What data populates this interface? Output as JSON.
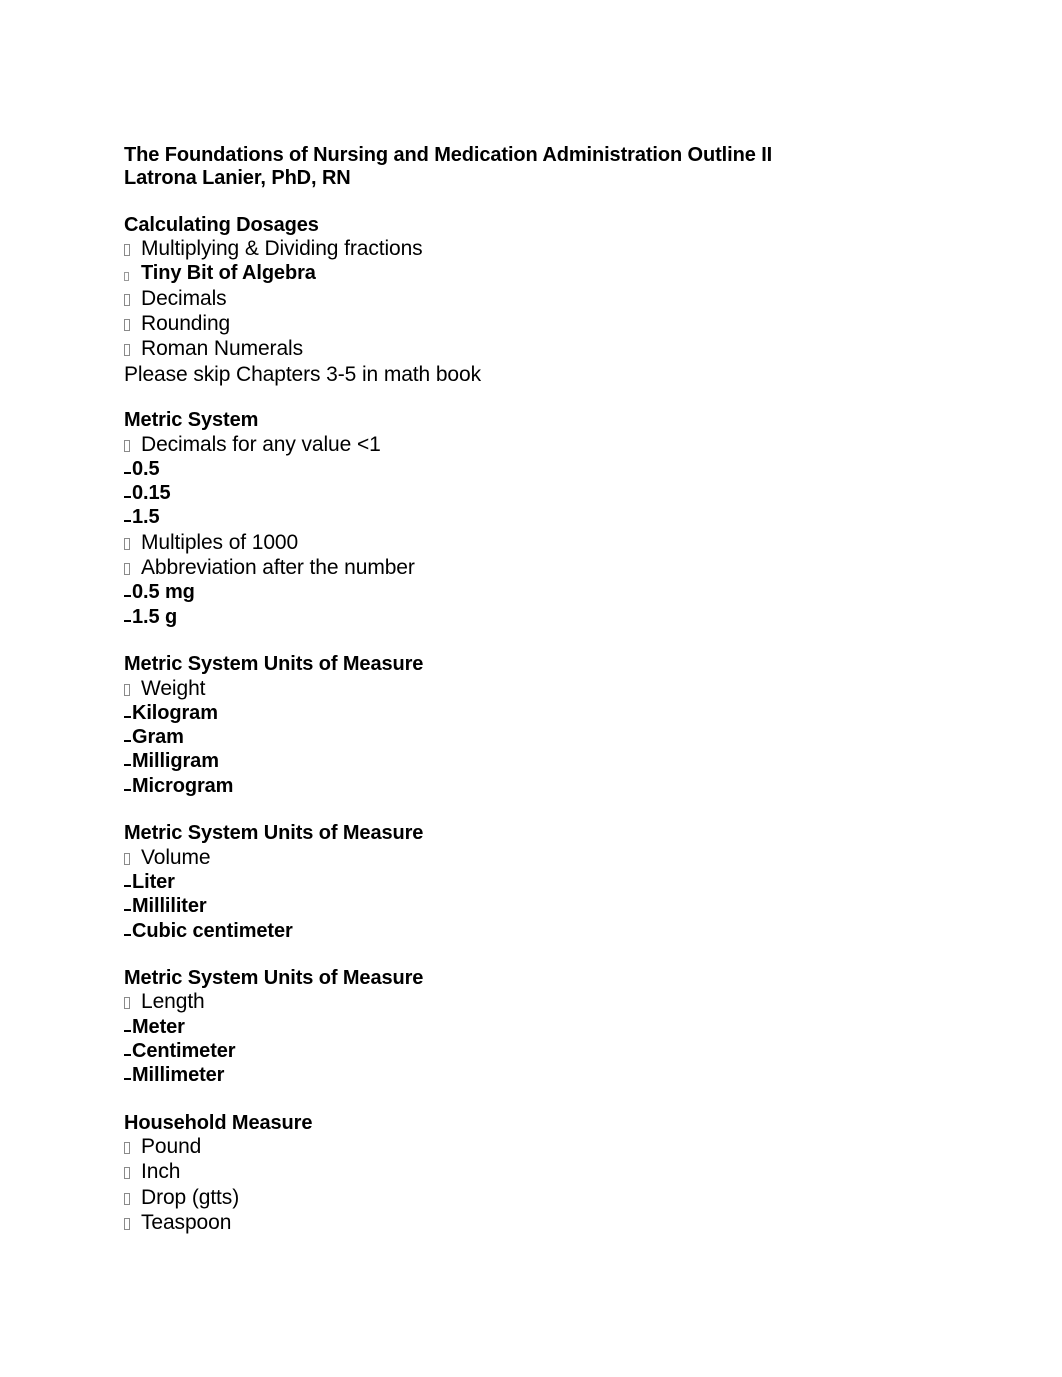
{
  "document": {
    "title_line_1": "The Foundations of Nursing and Medication Administration Outline II",
    "author_line": "Latrona Lanier, PhD, RN"
  },
  "sections": [
    {
      "heading": "Calculating Dosages",
      "items": [
        {
          "marker": "tofu",
          "text": "Multiplying & Dividing fractions",
          "bold": false
        },
        {
          "marker": "tofu",
          "text": "Tiny Bit of Algebra",
          "bold": true
        },
        {
          "marker": "tofu",
          "text": "Decimals",
          "bold": false
        },
        {
          "marker": "tofu",
          "text": "Rounding",
          "bold": false
        },
        {
          "marker": "tofu",
          "text": "Roman Numerals",
          "bold": false
        },
        {
          "marker": "none",
          "text": "Please skip Chapters 3-5 in math book",
          "bold": false
        }
      ]
    },
    {
      "heading": "Metric System",
      "items": [
        {
          "marker": "tofu",
          "text": "Decimals for any value <1",
          "bold": false
        },
        {
          "marker": "dash",
          "text": "0.5",
          "bold": true
        },
        {
          "marker": "dash",
          "text": "0.15",
          "bold": true
        },
        {
          "marker": "dash",
          "text": "1.5",
          "bold": true
        },
        {
          "marker": "tofu",
          "text": "Multiples of 1000",
          "bold": false
        },
        {
          "marker": "tofu",
          "text": "Abbreviation after the number",
          "bold": false
        },
        {
          "marker": "dash",
          "text": "0.5 mg",
          "bold": true
        },
        {
          "marker": "dash",
          "text": "1.5 g",
          "bold": true
        }
      ]
    },
    {
      "heading": "Metric System Units of Measure",
      "items": [
        {
          "marker": "tofu",
          "text": "Weight",
          "bold": false
        },
        {
          "marker": "dash",
          "text": "Kilogram",
          "bold": true
        },
        {
          "marker": "dash",
          "text": "Gram",
          "bold": true
        },
        {
          "marker": "dash",
          "text": "Milligram",
          "bold": true
        },
        {
          "marker": "dash",
          "text": "Microgram",
          "bold": true
        }
      ]
    },
    {
      "heading": "Metric System Units of Measure",
      "items": [
        {
          "marker": "tofu",
          "text": "Volume",
          "bold": false
        },
        {
          "marker": "dash",
          "text": "Liter",
          "bold": true
        },
        {
          "marker": "dash",
          "text": "Milliliter",
          "bold": true
        },
        {
          "marker": "dash",
          "text": "Cubic centimeter",
          "bold": true
        }
      ]
    },
    {
      "heading": "Metric System Units of Measure",
      "items": [
        {
          "marker": "tofu",
          "text": "Length",
          "bold": false
        },
        {
          "marker": "dash",
          "text": "Meter",
          "bold": true
        },
        {
          "marker": "dash",
          "text": "Centimeter",
          "bold": true
        },
        {
          "marker": "dash",
          "text": "Millimeter",
          "bold": true
        }
      ]
    },
    {
      "heading": "Household Measure",
      "items": [
        {
          "marker": "tofu",
          "text": "Pound",
          "bold": false
        },
        {
          "marker": "tofu",
          "text": "Inch",
          "bold": false
        },
        {
          "marker": "tofu",
          "text": "Drop (gtts)",
          "bold": false
        },
        {
          "marker": "tofu",
          "text": "Teaspoon",
          "bold": false
        }
      ]
    }
  ]
}
